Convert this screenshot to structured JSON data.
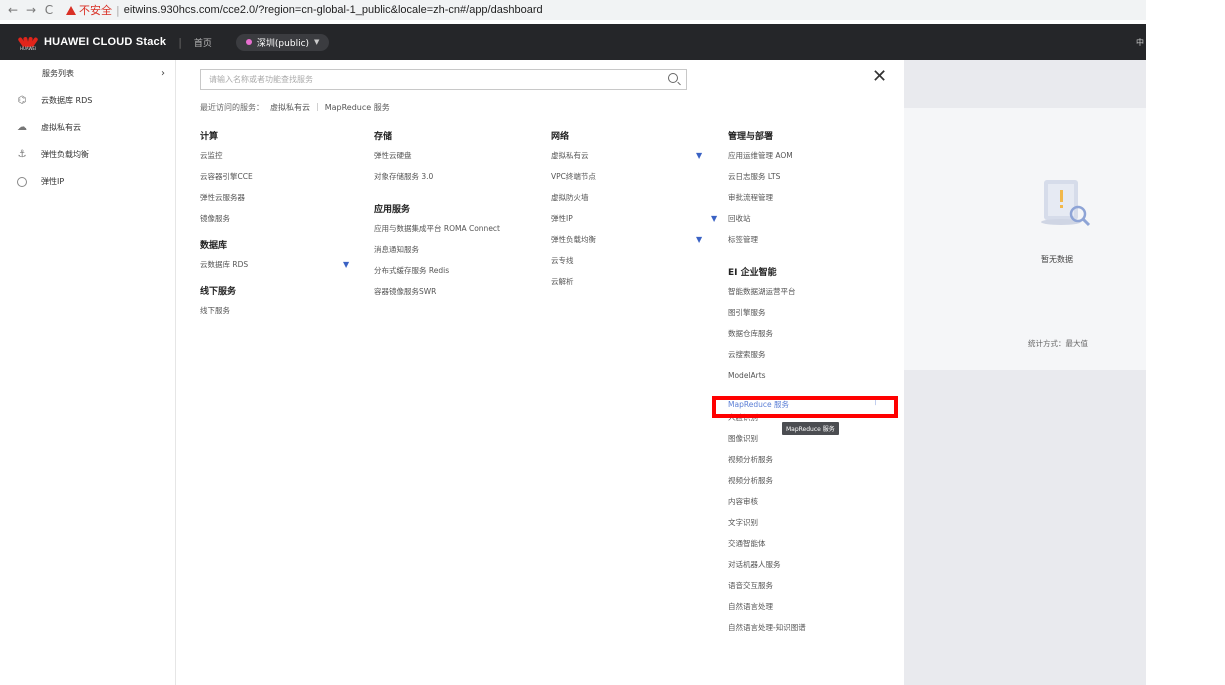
{
  "browser": {
    "back": "←",
    "forward": "→",
    "reload": "C",
    "insecure_label": "不安全",
    "url": "eitwins.930hcs.com/cce2.0/?region=cn-global-1_public&locale=zh-cn#/app/dashboard"
  },
  "topnav": {
    "brand": "HUAWEI CLOUD Stack",
    "logo_sub": "HUAWEI",
    "home": "首页",
    "region": "深圳(public)",
    "lang": "中"
  },
  "sidebar": {
    "header": "服务列表",
    "items": [
      {
        "label": "云数据库 RDS",
        "icon": "database-icon"
      },
      {
        "label": "虚拟私有云",
        "icon": "cloud-icon"
      },
      {
        "label": "弹性负载均衡",
        "icon": "anchor-icon"
      },
      {
        "label": "弹性IP",
        "icon": "ip-icon"
      }
    ]
  },
  "panel": {
    "search_placeholder": "请输入名称或者功能查找服务",
    "recent_label": "最近访问的服务：",
    "recent_items": [
      "虚拟私有云",
      "MapReduce 服务"
    ],
    "groups": {
      "compute": {
        "title": "计算",
        "items": [
          "云监控",
          "云容器引擎CCE",
          "弹性云服务器",
          "镜像服务"
        ]
      },
      "database": {
        "title": "数据库",
        "items": [
          "云数据库 RDS"
        ]
      },
      "offline": {
        "title": "线下服务",
        "items": [
          "线下服务"
        ]
      },
      "storage": {
        "title": "存储",
        "items": [
          "弹性云硬盘",
          "对象存储服务 3.0"
        ]
      },
      "appsvc": {
        "title": "应用服务",
        "items": [
          "应用与数据集成平台 ROMA Connect",
          "消息通知服务",
          "分布式缓存服务 Redis",
          "容器镜像服务SWR"
        ]
      },
      "network": {
        "title": "网络",
        "items": [
          "虚拟私有云",
          "VPC终端节点",
          "虚拟防火墙",
          "弹性IP",
          "弹性负载均衡",
          "云专线",
          "云解析"
        ]
      },
      "mgmt": {
        "title": "管理与部署",
        "items": [
          "应用运维管理 AOM",
          "云日志服务 LTS",
          "审批流程管理",
          "回收站",
          "标签管理"
        ]
      },
      "ei": {
        "title": "EI 企业智能",
        "items": [
          "智能数据湖运营平台",
          "图引擎服务",
          "数据仓库服务",
          "云搜索服务",
          "ModelArts",
          "MapReduce 服务",
          "人脸识别",
          "图像识别",
          "视频分析服务",
          "视频分析服务",
          "内容审核",
          "文字识别",
          "交通智能体",
          "对话机器人服务",
          "语音交互服务",
          "自然语言处理",
          "自然语言处理-知识图谱"
        ]
      }
    },
    "tooltip": "MapReduce 服务"
  },
  "dashboard": {
    "empty_text": "暂无数据",
    "stat_text": "统计方式：最大值"
  },
  "colors": {
    "highlight": "#ff0000",
    "pin": "#3a62c4",
    "topnav": "#252629"
  }
}
